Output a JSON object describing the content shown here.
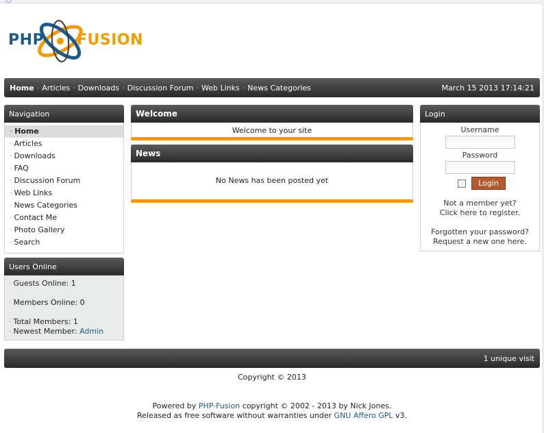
{
  "logo": {
    "text_php": "PHP",
    "text_fusion": "FUSION",
    "colors": {
      "blue": "#1d5a8a",
      "orange": "#f29a00"
    }
  },
  "subheader": {
    "links": [
      "Home",
      "Articles",
      "Downloads",
      "Discussion Forum",
      "Web Links",
      "News Categories"
    ],
    "active": "Home",
    "datetime": "March 15 2013 17:14:21"
  },
  "navigation": {
    "title": "Navigation",
    "items": [
      "Home",
      "Articles",
      "Downloads",
      "FAQ",
      "Discussion Forum",
      "Web Links",
      "News Categories",
      "Contact Me",
      "Photo Gallery",
      "Search"
    ]
  },
  "users_online": {
    "title": "Users Online",
    "guests_label": "Guests Online: 1",
    "members_label": "Members Online: 0",
    "total_label": "Total Members: 1",
    "newest_label": "Newest Member:",
    "newest_name": "Admin"
  },
  "welcome": {
    "title": "Welcome",
    "message": "Welcome to your site"
  },
  "news": {
    "title": "News",
    "message": "No News has been posted yet"
  },
  "login": {
    "title": "Login",
    "username_label": "Username",
    "password_label": "Password",
    "button_label": "Login",
    "not_member": "Not a member yet?",
    "click_register": "Click here to register.",
    "forgot": "Forgotten your password?",
    "request": "Request a new one here."
  },
  "footer": {
    "visits": "1 unique visit",
    "copyright": "Copyright © 2013",
    "powered_prefix": "Powered by",
    "powered_link": "PHP-Fusion",
    "powered_suffix": "copyright © 2002 - 2013 by Nick Jones.",
    "released_prefix": "Released as free software without warranties under",
    "license_link": "GNU Affero GPL",
    "released_suffix": "v3."
  }
}
